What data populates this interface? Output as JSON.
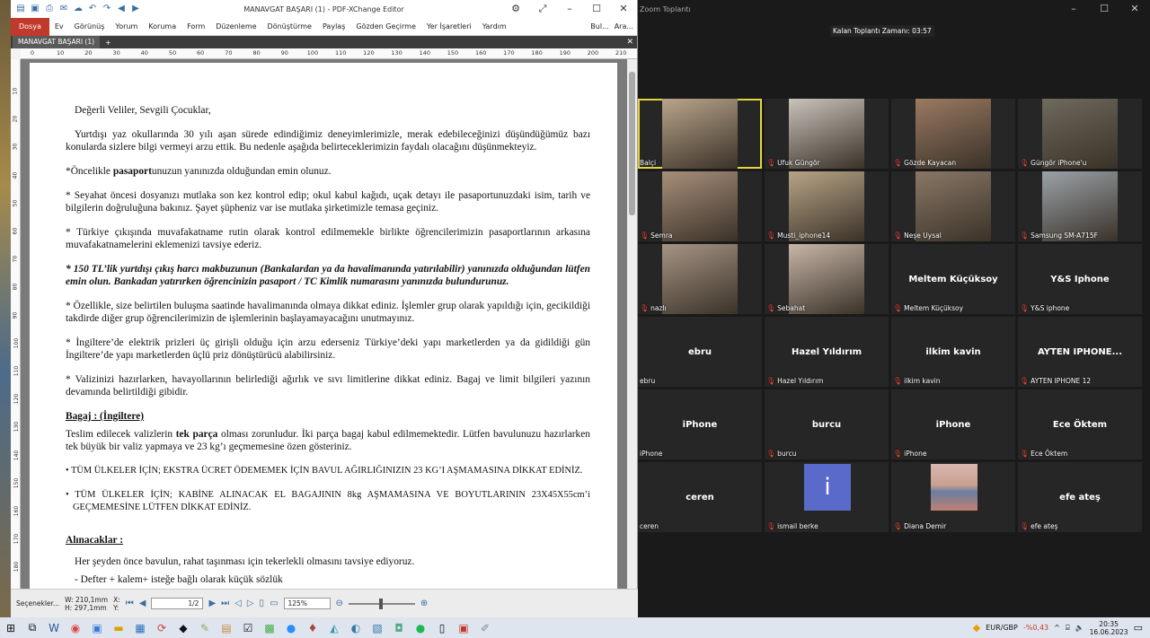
{
  "pdf": {
    "title": "MANAVGAT BAŞARI (1) - PDF-XChange Editor",
    "menu": [
      "Dosya",
      "Ev",
      "Görünüş",
      "Yorum",
      "Koruma",
      "Form",
      "Düzenleme",
      "Dönüştürme",
      "Paylaş",
      "Gözden Geçirme",
      "Yer İşaretleri",
      "Yardım"
    ],
    "menu_right": [
      "Bul...",
      "Ara..."
    ],
    "tab": "MANAVGAT BAŞARI (1)",
    "ruler_h": [
      "0",
      "10",
      "20",
      "30",
      "40",
      "50",
      "60",
      "70",
      "80",
      "90",
      "100",
      "110",
      "120",
      "130",
      "140",
      "150",
      "160",
      "170",
      "180",
      "190",
      "200",
      "210"
    ],
    "ruler_v": [
      "10",
      "20",
      "30",
      "40",
      "50",
      "60",
      "70",
      "80",
      "90",
      "100",
      "110",
      "120",
      "130",
      "140",
      "150",
      "160",
      "170",
      "180"
    ],
    "doc": {
      "greeting": "Değerli Veliler, Sevgili Çocuklar,",
      "p1": "Yurtdışı yaz okullarında 30 yılı aşan sürede edindiğimiz deneyimlerimizle, merak edebileceğinizi düşündüğümüz bazı konularda sizlere bilgi vermeyi arzu ettik. Bu nedenle aşağıda belirteceklerimizin faydalı olacağını düşünmekteyiz.",
      "p2_a": "*Öncelikle ",
      "p2_b": "pasaport",
      "p2_c": "unuzun yanınızda olduğundan emin olunuz.",
      "p3": "* Seyahat öncesi dosyanızı mutlaka son kez kontrol edip; okul kabul kağıdı, uçak detayı ile pasaportunuzdaki isim, tarih ve bilgilerin doğruluğuna bakınız. Şayet şüpheniz var ise mutlaka şirketimizle temasa geçiniz.",
      "p4": "* Türkiye çıkışında muvafakatname rutin olarak kontrol edilmemekle birlikte öğrencilerimizin pasaportlarının arkasına muvafakatnamelerini eklemenizi tavsiye ederiz.",
      "p5": "* 150 TL’lik yurtdışı çıkış harcı makbuzunun (Bankalardan ya da havalimanında yatırılabilir) yanınızda olduğundan lütfen emin olun. Bankadan yatırırken öğrencinizin pasaport / TC Kimlik numarasını yanınızda bulundurunuz.",
      "p6": "* Özellikle, size belirtilen buluşma saatinde havalimanında olmaya dikkat ediniz. İşlemler grup olarak yapıldığı için, gecikildiği takdirde diğer grup öğrencilerimizin de işlemlerinin başlayamayacağını unutmayınız.",
      "p7": "* İngiltere’de elektrik prizleri üç girişli olduğu için arzu ederseniz Türkiye’deki yapı marketlerden ya da gidildiği gün İngiltere’de yapı marketlerden üçlü priz dönüştürücü alabilirsiniz.",
      "p8": "* Valizinizi hazırlarken, havayollarının belirlediği ağırlık ve sıvı limitlerine dikkat ediniz. Bagaj ve limit bilgileri yazının devamında belirtildiği gibidir.",
      "h1": "Bagaj : (İngiltere)",
      "p9_a": "Teslim edilecek valizlerin ",
      "p9_b": "tek parça",
      "p9_c": " olması zorunludur. İki parça bagaj kabul edilmemektedir. Lütfen bavulunuzu hazırlarken tek büyük bir valiz yapmaya ve 23 kg’ı geçmemesine özen gösteriniz.",
      "b1": "• TÜM ÜLKELER İÇİN; EKSTRA ÜCRET ÖDEMEMEK İÇİN BAVUL AĞIRLIĞINIZIN 23 KG’I AŞMAMASINA DİKKAT EDİNİZ.",
      "b2": "• TÜM ÜLKELER İÇİN; KABİNE ALINACAK EL BAGAJININ 8kg AŞMAMASINA VE BOYUTLARININ 23X45X55cm’i GEÇMEMESİNE LÜTFEN DİKKAT EDİNİZ.",
      "h2": "Alınacaklar :",
      "p10": "Her şeyden önce bavulun, rahat taşınması için tekerlekli olmasını tavsiye ediyoruz.",
      "p11": "- Defter + kalem+ isteğe bağlı olarak küçük sözlük"
    },
    "status": {
      "options": "Seçenekler...",
      "w": "W: 210,1mm",
      "h": "H: 297,1mm",
      "x": "X:",
      "y": "Y:",
      "page": "1",
      "pages": "/2",
      "zoom": "125%"
    }
  },
  "zoom": {
    "title": "Zoom Toplantı",
    "timer": "Kalan Toplantı Zamanı: 03:57",
    "participants": [
      {
        "name": "Balçi",
        "video": true,
        "active": true,
        "color": "#b9a48a"
      },
      {
        "name": "Ufuk Güngör",
        "video": true,
        "color": "#c9c3bb"
      },
      {
        "name": "Gözde Kayacan",
        "video": true,
        "color": "#9a7a62"
      },
      {
        "name": "Güngör iPhone'u",
        "video": true,
        "color": "#6e6a5c"
      },
      {
        "name": "Semra",
        "video": true,
        "color": "#a88e7a"
      },
      {
        "name": "Musti_iphone14",
        "video": true,
        "color": "#b8a486"
      },
      {
        "name": "Neşe Uysal",
        "video": true,
        "color": "#8a7866"
      },
      {
        "name": "Samsung SM-A715F",
        "video": true,
        "color": "#9aa2a8"
      },
      {
        "name": "nazlı",
        "video": true,
        "color": "#a69484"
      },
      {
        "name": "Sebahat",
        "video": true,
        "color": "#c8b6a8"
      },
      {
        "name": "Meltem Küçüksoy",
        "big": "Meltem Küçüksoy"
      },
      {
        "name": "Y&S iphone",
        "big": "Y&S Iphone"
      },
      {
        "name": "ebru",
        "big": "ebru",
        "nomic": true
      },
      {
        "name": "Hazel Yıldırım",
        "big": "Hazel Yıldırım"
      },
      {
        "name": "ilkim kavin",
        "big": "ilkim kavin"
      },
      {
        "name": "AYTEN IPHONE 12",
        "big": "AYTEN  IPHONE..."
      },
      {
        "name": "iPhone",
        "big": "iPhone",
        "nomic": true
      },
      {
        "name": "burcu",
        "big": "burcu"
      },
      {
        "name": "iPhone",
        "big": "iPhone"
      },
      {
        "name": "Ece Öktem",
        "big": "Ece Öktem"
      },
      {
        "name": "ceren",
        "big": "ceren",
        "nomic": true
      },
      {
        "name": "ismail berke",
        "avatar": "i"
      },
      {
        "name": "Diana Demir",
        "pic": true
      },
      {
        "name": "efe ateş",
        "big": "efe ateş"
      }
    ]
  },
  "taskbar": {
    "currency": "EUR/GBP",
    "change": "-%0,43",
    "time": "20:35",
    "date": "16.06.2023"
  }
}
